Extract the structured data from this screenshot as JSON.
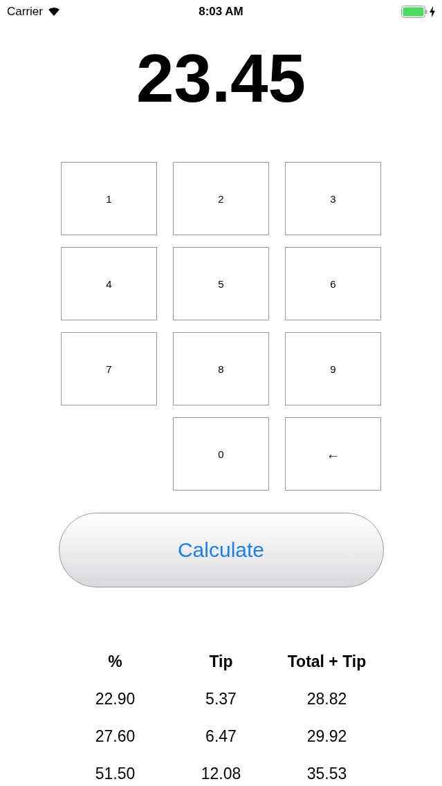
{
  "status_bar": {
    "carrier": "Carrier",
    "time": "8:03 AM",
    "charging": true
  },
  "amount": "23.45",
  "keypad": [
    {
      "label": "1",
      "kind": "digit"
    },
    {
      "label": "2",
      "kind": "digit"
    },
    {
      "label": "3",
      "kind": "digit"
    },
    {
      "label": "4",
      "kind": "digit"
    },
    {
      "label": "5",
      "kind": "digit"
    },
    {
      "label": "6",
      "kind": "digit"
    },
    {
      "label": "7",
      "kind": "digit"
    },
    {
      "label": "8",
      "kind": "digit"
    },
    {
      "label": "9",
      "kind": "digit"
    },
    {
      "label": "0",
      "kind": "digit"
    },
    {
      "label": "←",
      "kind": "backspace"
    }
  ],
  "calculate_button": "Calculate",
  "table": {
    "columns": [
      "%",
      "Tip",
      "Total + Tip"
    ],
    "rows": [
      [
        "22.90",
        "5.37",
        "28.82"
      ],
      [
        "27.60",
        "6.47",
        "29.92"
      ],
      [
        "51.50",
        "12.08",
        "35.53"
      ]
    ]
  }
}
